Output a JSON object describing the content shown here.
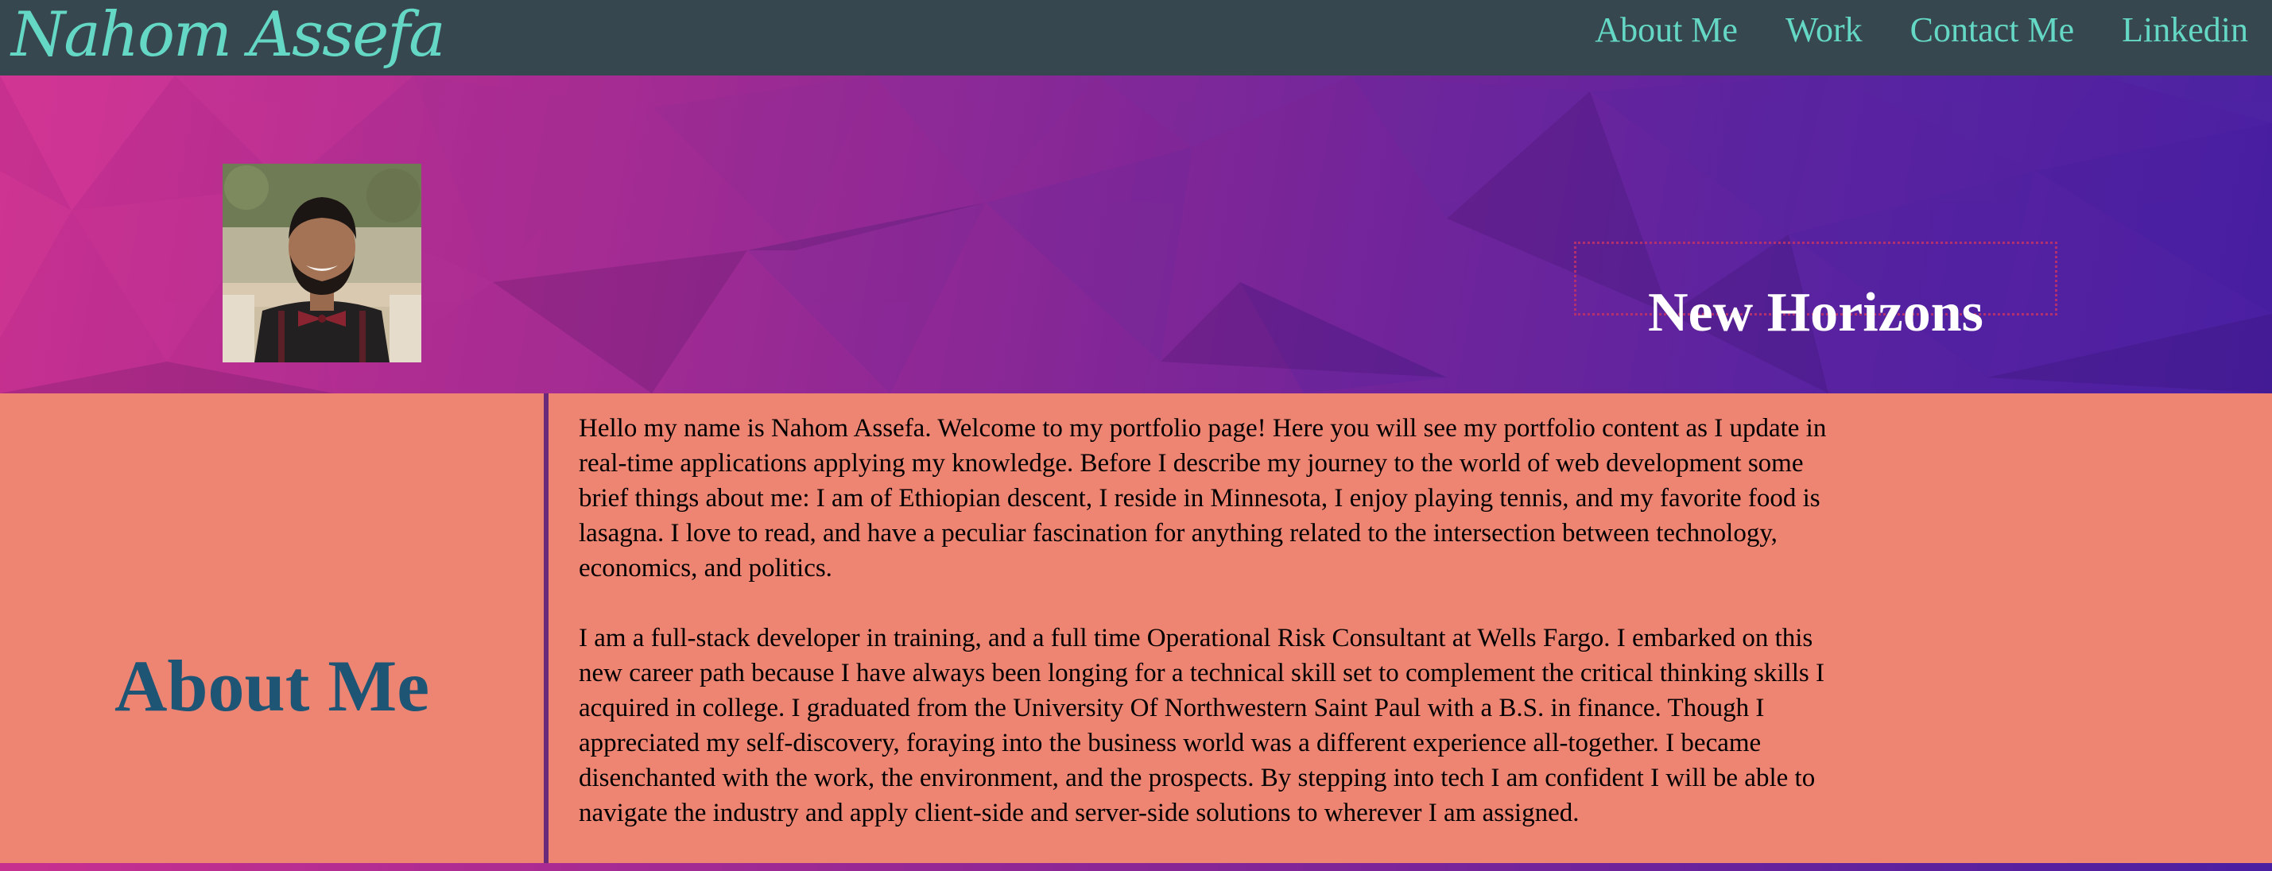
{
  "nav": {
    "brand": "Nahom Assefa",
    "links": [
      "About Me",
      "Work",
      "Contact Me",
      "Linkedin"
    ]
  },
  "hero": {
    "title": "New Horizons",
    "portrait_alt": "Portrait photo of Nahom Assefa"
  },
  "about": {
    "heading": "About Me",
    "paragraphs": [
      "Hello my name is Nahom Assefa. Welcome to my portfolio page! Here you will see my portfolio content as I update in real-time applications applying my knowledge. Before I describe my journey to the world of web development some brief things about me: I am of Ethiopian descent, I reside in Minnesota, I enjoy playing tennis, and my favorite food is lasagna. I love to read, and have a peculiar fascination for anything related to the intersection between technology, economics, and politics.",
      "I am a full-stack developer in training, and a full time Operational Risk Consultant at Wells Fargo. I embarked on this new career path because I have always been longing for a technical skill set to complement the critical thinking skills I acquired in college. I graduated from the University Of Northwestern Saint Paul with a B.S. in finance. Though I appreciated my self-discovery, foraying into the business world was a different experience all-together. I became disenchanted with the work, the environment, and the prospects. By stepping into tech I am confident I will be able to navigate the industry and apply client-side and server-side solutions to wherever I am assigned."
    ]
  },
  "colors": {
    "nav_bg": "#37474f",
    "nav_text": "#64d8c4",
    "about_bg": "#ee8573",
    "about_heading": "#1e5575",
    "hero_gradient_start": "#c8308f",
    "hero_gradient_end": "#4a1fa2"
  }
}
